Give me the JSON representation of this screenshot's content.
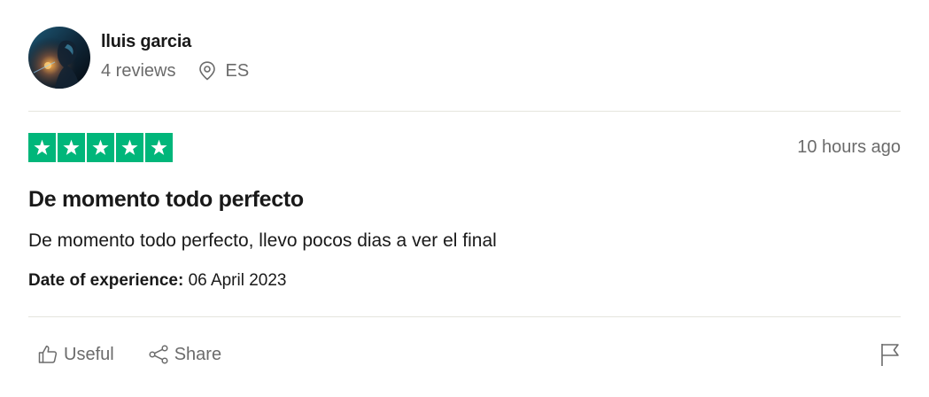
{
  "reviewer": {
    "name": "lluis garcia",
    "reviews_count": "4 reviews",
    "location": "ES",
    "avatar_icon": "profile-photo"
  },
  "review": {
    "rating": 5,
    "rating_max": 5,
    "star_color": "#00b67a",
    "timestamp": "10 hours ago",
    "title": "De momento todo perfecto",
    "body": "De momento todo perfecto, llevo pocos dias a ver el final",
    "experience_label": "Date of experience:",
    "experience_date": "06 April 2023"
  },
  "actions": {
    "useful_label": "Useful",
    "useful_icon": "thumbs-up-icon",
    "share_label": "Share",
    "share_icon": "share-icon",
    "report_icon": "flag-icon"
  }
}
